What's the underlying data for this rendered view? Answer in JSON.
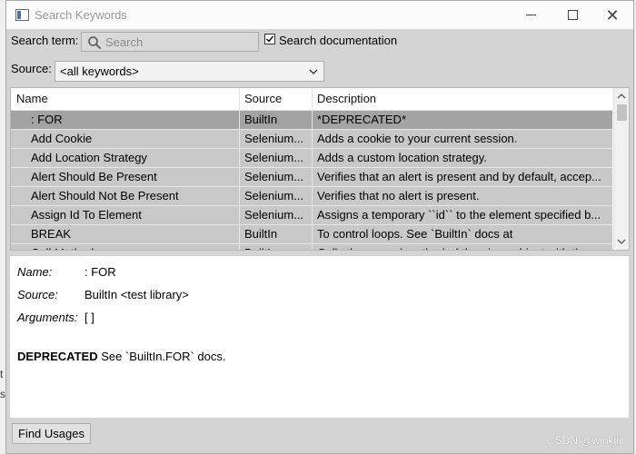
{
  "window": {
    "title": "Search Keywords",
    "controls": {
      "minimize_icon": "minimize-icon",
      "maximize_icon": "maximize-icon",
      "close_icon": "close-icon"
    }
  },
  "search": {
    "label": "Search term:",
    "placeholder": "Search",
    "checkbox_label": "Search documentation",
    "checkbox_checked": true
  },
  "source": {
    "label": "Source:",
    "selected": "<all keywords>"
  },
  "table": {
    "columns": [
      "Name",
      "Source",
      "Description"
    ],
    "rows": [
      {
        "name": ": FOR",
        "source": "BuiltIn",
        "description": "*DEPRECATED*",
        "selected": true
      },
      {
        "name": "Add Cookie",
        "source": "Selenium...",
        "description": "Adds a cookie to your current session."
      },
      {
        "name": "Add Location Strategy",
        "source": "Selenium...",
        "description": "Adds a custom location strategy."
      },
      {
        "name": "Alert Should Be Present",
        "source": "Selenium...",
        "description": "Verifies that an alert is present and by default, accep..."
      },
      {
        "name": "Alert Should Not Be Present",
        "source": "Selenium...",
        "description": "Verifies that no alert is present."
      },
      {
        "name": "Assign Id To Element",
        "source": "Selenium...",
        "description": "Assigns a temporary ``id`` to the element specified b..."
      },
      {
        "name": "BREAK",
        "source": "BuiltIn",
        "description": "To control loops. See `BuiltIn` docs at"
      },
      {
        "name": "Call Method",
        "source": "BuiltIn",
        "description": "Calls the named method of the given object with the"
      }
    ]
  },
  "details": {
    "name_label": "Name:",
    "name_value": ": FOR",
    "source_label": "Source:",
    "source_value": "BuiltIn <test library>",
    "arguments_label": "Arguments:",
    "arguments_value": "[ ]",
    "doc_strong": "DEPRECATED",
    "doc_rest": " See `BuiltIn.FOR` docs."
  },
  "footer": {
    "find_usages": "Find Usages",
    "watermark": "CSDN @winkiiii"
  },
  "backdrop_text": [
    "t",
    "s"
  ]
}
